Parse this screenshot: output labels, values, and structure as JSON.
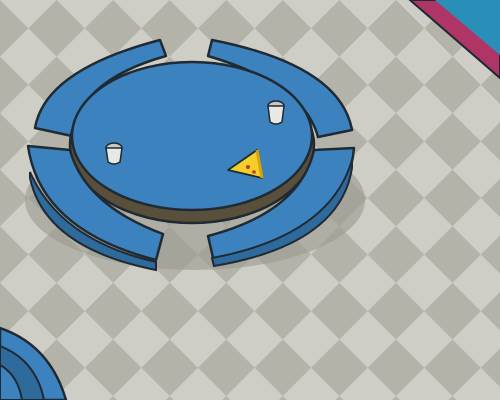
{
  "scene": {
    "type": "isometric cafe room",
    "floor_colors": {
      "light": "#cfcec6",
      "dark": "#b4b3aa",
      "grout": "#a9a89f"
    },
    "table_color": "#3b82be",
    "table_rim_color": "#2f6a9c",
    "outline_color": "#1f2a33",
    "shadow_color": "#9a9990",
    "wall_colors": {
      "outer": "#b03567",
      "inner": "#2a8fb8"
    }
  },
  "objects": {
    "table": {
      "name": "round-table",
      "bench_segments": 4
    },
    "items_on_table": [
      {
        "name": "cup-left",
        "icon": "cup-icon"
      },
      {
        "name": "cup-right",
        "icon": "cup-icon"
      },
      {
        "name": "pizza-slice",
        "icon": "pizza-slice-icon"
      }
    ],
    "second_table": {
      "name": "partial-table-bottom-left",
      "bench_segments": 2
    }
  }
}
